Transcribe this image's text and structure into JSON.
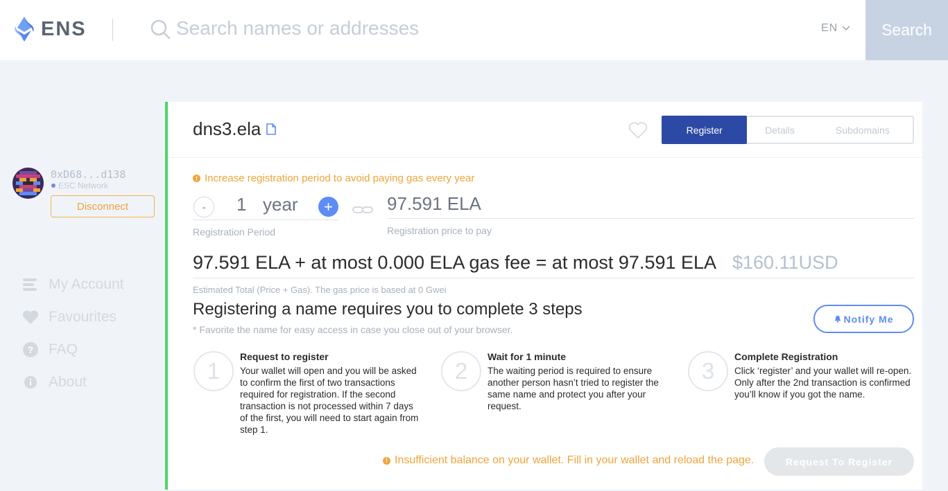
{
  "header": {
    "logo_text": "ENS",
    "search_placeholder": "Search names or addresses",
    "language": "EN",
    "search_button": "Search"
  },
  "sidebar": {
    "address": "0xD68...d138",
    "network": "ESC Network",
    "disconnect": "Disconnect",
    "nav": [
      {
        "label": "My Account",
        "icon": "list-icon"
      },
      {
        "label": "Favourites",
        "icon": "heart-icon"
      },
      {
        "label": "FAQ",
        "icon": "question-icon"
      },
      {
        "label": "About",
        "icon": "info-icon"
      }
    ]
  },
  "domain": {
    "name": "dns3.ela",
    "tabs": [
      "Register",
      "Details",
      "Subdomains"
    ],
    "active_tab": "Register"
  },
  "registration": {
    "warning": "Increase registration period to avoid paying gas every year",
    "period_value": "1",
    "period_unit": "year",
    "period_label": "Registration Period",
    "price": "97.591 ELA",
    "price_label": "Registration price to pay",
    "total": "97.591 ELA + at most 0.000 ELA gas fee = at most 97.591 ELA",
    "total_usd": "$160.11USD",
    "total_note": "Estimated Total (Price + Gas). The gas price is based at 0 Gwei"
  },
  "steps": {
    "title": "Registering a name requires you to complete 3 steps",
    "note": "* Favorite the name for easy access in case you close out of your browser.",
    "notify_button": "Notify Me",
    "items": [
      {
        "number": "1",
        "title": "Request to register",
        "desc": "Your wallet will open and you will be asked to confirm the first of two transactions required for registration. If the second transaction is not processed within 7 days of the first, you will need to start again from step 1."
      },
      {
        "number": "2",
        "title": "Wait for 1 minute",
        "desc": "The waiting period is required to ensure another person hasn’t tried to register the same name and protect you after your request."
      },
      {
        "number": "3",
        "title": "Complete Registration",
        "desc": "Click ‘register’ and your wallet will re-open. Only after the 2nd transaction is confirmed you’ll know if you got the name."
      }
    ]
  },
  "footer": {
    "balance_warning": "Insufficient balance on your wallet. Fill in your wallet and reload the page.",
    "request_button": "Request To Register"
  },
  "colors": {
    "accent": "#2c4aa5",
    "blue": "#5d8cf5",
    "warning": "#f0a43a",
    "success_border": "#4fd466"
  }
}
